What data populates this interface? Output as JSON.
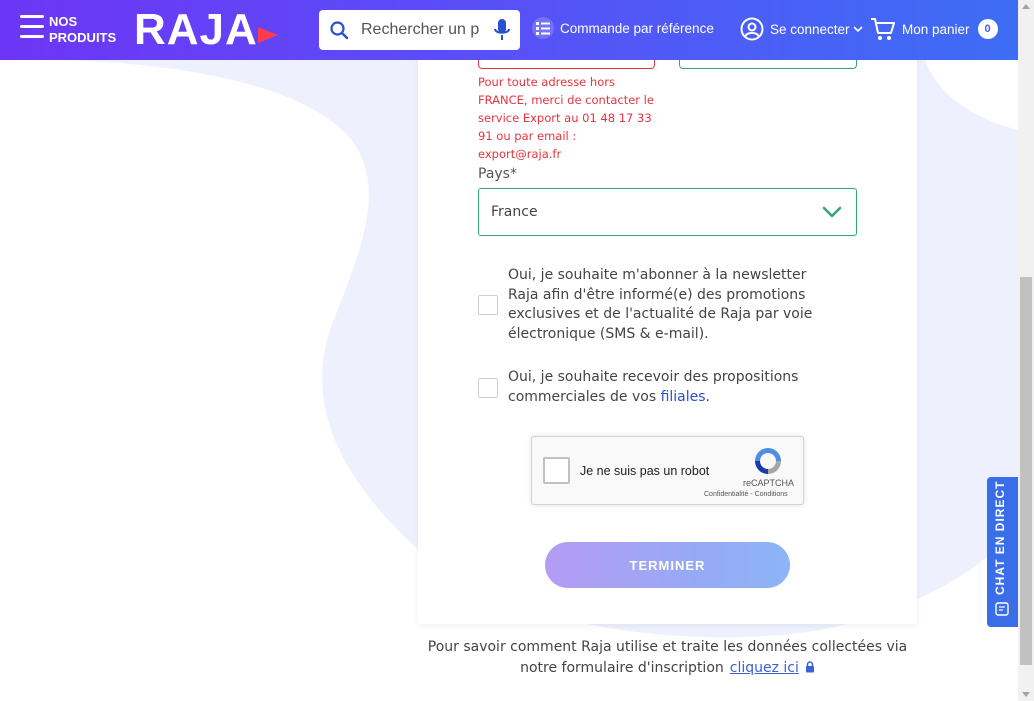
{
  "header": {
    "menu_label": "NOS PRODUITS",
    "logo_text": "RAJA",
    "search_placeholder": "Rechercher un produit",
    "order_by_reference": "Commande par référence",
    "login": "Se connecter",
    "cart": "Mon panier",
    "cart_count": "0"
  },
  "form": {
    "address_error": "Pour toute adresse hors FRANCE, merci de contacter le service Export au 01 48 17 33 91 ou par email : export@raja.fr",
    "country_label": "Pays*",
    "country_value": "France",
    "newsletter_consent": "Oui, je souhaite m'abonner à la newsletter Raja afin d'être informé(e) des promotions exclusives et de l'actualité de Raja par voie électronique (SMS & e-mail).",
    "partners_consent_prefix": "Oui, je souhaite recevoir des propositions commerciales de vos ",
    "partners_consent_link": "filiales",
    "partners_consent_suffix": ".",
    "recaptcha_label": "Je ne suis pas un robot",
    "recaptcha_brand": "reCAPTCHA",
    "recaptcha_terms": "Confidentialité - Conditions",
    "submit_label": "TERMINER"
  },
  "footer": {
    "privacy_text": "Pour savoir comment Raja utilise et traite les données collectées via notre formulaire d'inscription",
    "privacy_link": "cliquez ici"
  },
  "chat": {
    "label": "CHAT EN DIRECT"
  },
  "colors": {
    "header_start": "#6d35f5",
    "header_end": "#3d6df5",
    "error": "#e5343f",
    "valid": "#37a772",
    "link": "#3b5fd9",
    "chat": "#3a6ee8"
  }
}
